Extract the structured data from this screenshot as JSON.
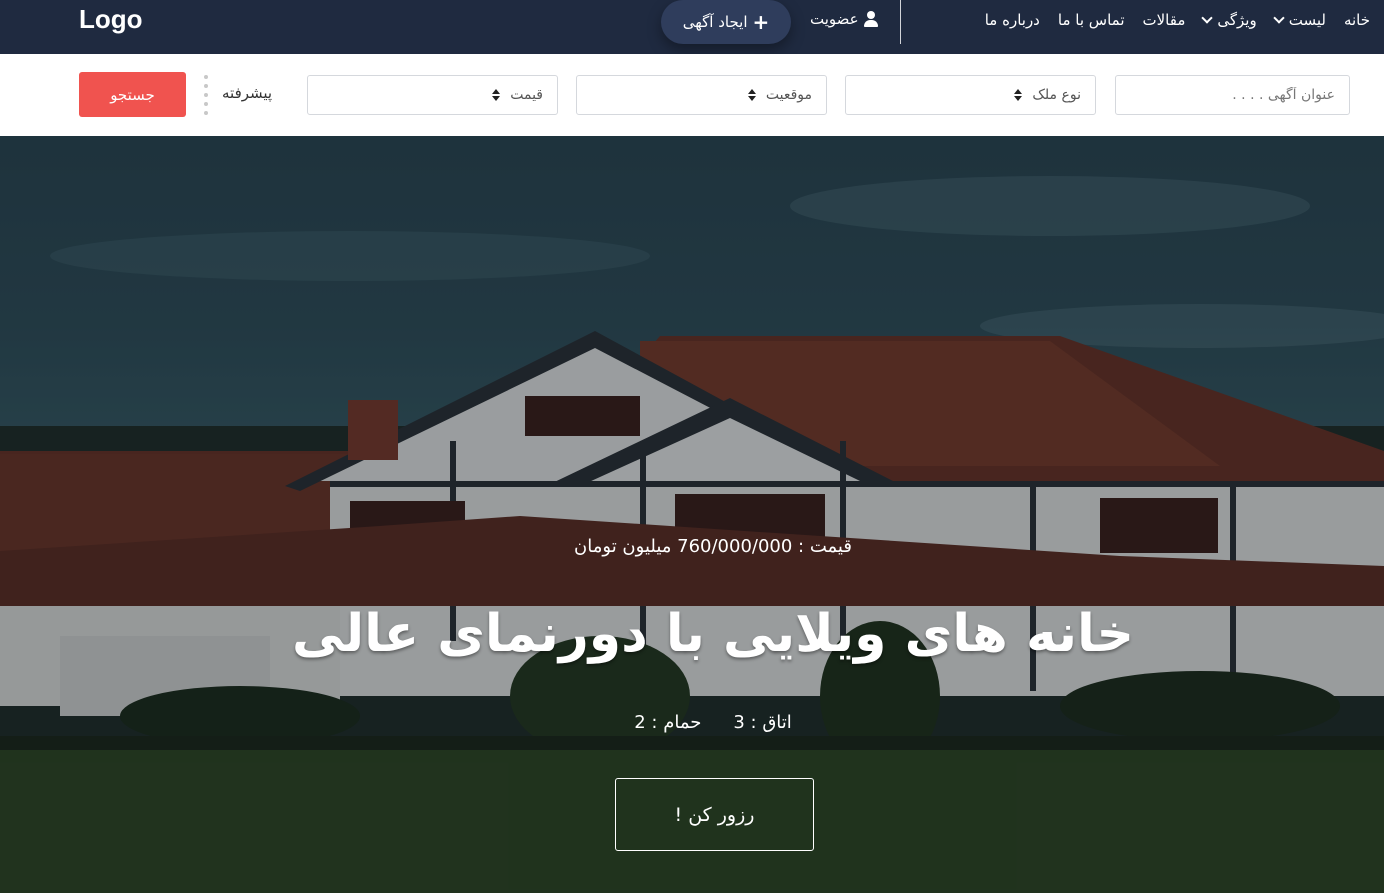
{
  "navbar": {
    "logo": "Logo",
    "menu": [
      {
        "label": "خانه",
        "has_dropdown": false
      },
      {
        "label": "لیست",
        "has_dropdown": true
      },
      {
        "label": "ویژگی",
        "has_dropdown": true
      },
      {
        "label": "مقالات",
        "has_dropdown": false
      },
      {
        "label": "تماس با ما",
        "has_dropdown": false
      },
      {
        "label": "درباره ما",
        "has_dropdown": false
      }
    ],
    "member_label": "عضویت",
    "member_icon": "user-icon",
    "create_ad_label": "ایجاد آگهی",
    "create_ad_icon": "plus-icon"
  },
  "search": {
    "title_placeholder": "عنوان آگهی . . . .",
    "type_label": "نوع ملک",
    "location_label": "موقعیت",
    "price_label": "قیمت",
    "advanced_label": "پیشرفته",
    "search_button": "جستجو",
    "accent_color": "#f0534f"
  },
  "hero": {
    "price": "قیمت : 760/000/000 میلیون تومان",
    "title": "خانه های ویلایی با دورنمای عالی",
    "rooms": "اتاق : 3",
    "baths": "حمام : 2",
    "reserve_button": "رزور کن !"
  },
  "colors": {
    "navbar_bg": "#1f2a40",
    "create_button_bg": "#2f3d5c"
  }
}
